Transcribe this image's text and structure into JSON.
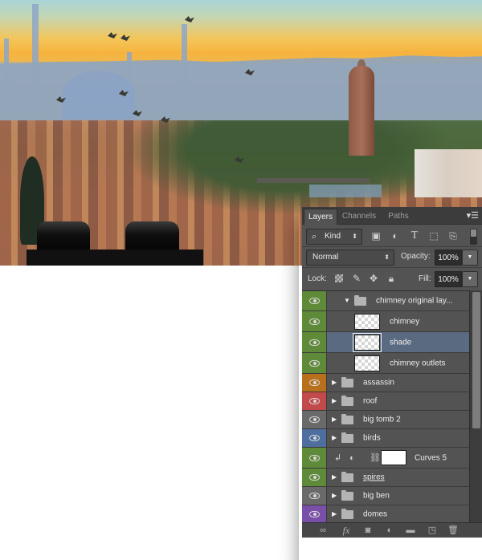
{
  "canvas": {
    "description": "Photoshop composite: Florence cityscape with ghosted mosque, flying birds, tall brick tower and black chimney shapes"
  },
  "layers_panel": {
    "tabs": [
      {
        "label": "Layers",
        "active": true
      },
      {
        "label": "Channels",
        "active": false
      },
      {
        "label": "Paths",
        "active": false
      }
    ],
    "menu_icon": "panel-menu-icon",
    "filter": {
      "kind_label": "Kind",
      "search_icon": "search-icon",
      "filter_icons": [
        "image-filter-icon",
        "adjustment-filter-icon",
        "type-filter-icon",
        "shape-filter-icon",
        "smart-object-filter-icon"
      ],
      "toggle_on": true
    },
    "blend_mode": "Normal",
    "opacity_label": "Opacity:",
    "opacity_value": "100%",
    "lock_label": "Lock:",
    "lock_icons": [
      "lock-transparent-icon",
      "lock-image-icon",
      "lock-position-icon",
      "lock-all-icon"
    ],
    "fill_label": "Fill:",
    "fill_value": "100%",
    "layers": [
      {
        "name": "chimney original lay...",
        "type": "group",
        "expanded": true,
        "visible": true,
        "color": "#5f8a3a",
        "indent": 0
      },
      {
        "name": "chimney",
        "type": "layer",
        "visible": true,
        "color": "#5f8a3a",
        "indent": 1,
        "selected": false
      },
      {
        "name": "shade",
        "type": "layer",
        "visible": true,
        "color": "#5f8a3a",
        "indent": 1,
        "selected": true
      },
      {
        "name": "chimney outlets",
        "type": "layer",
        "visible": true,
        "color": "#5f8a3a",
        "indent": 1,
        "selected": false
      },
      {
        "name": "assassin",
        "type": "group",
        "expanded": false,
        "visible": true,
        "color": "#b8701c"
      },
      {
        "name": "roof",
        "type": "group",
        "expanded": false,
        "visible": true,
        "color": "#c24a4a"
      },
      {
        "name": "big tomb 2",
        "type": "group",
        "expanded": false,
        "visible": true,
        "color": "#6a6a6a"
      },
      {
        "name": "birds",
        "type": "group",
        "expanded": false,
        "visible": true,
        "color": "#4e6ea0"
      },
      {
        "name": "Curves 5",
        "type": "adjustment",
        "visible": true,
        "color": "#5f8a3a",
        "clipped": true
      },
      {
        "name": "spires",
        "type": "group",
        "expanded": false,
        "visible": true,
        "color": "#5f8a3a",
        "underlined": true
      },
      {
        "name": "big ben",
        "type": "group",
        "expanded": false,
        "visible": true,
        "color": "#6a6a6a"
      },
      {
        "name": "domes",
        "type": "group",
        "expanded": false,
        "visible": true,
        "color": "#7a4fa8"
      }
    ],
    "scroll_fraction_visible": 0.6,
    "footer_icons": [
      {
        "name": "link-layers-icon",
        "glyph": "∞"
      },
      {
        "name": "fx-icon",
        "glyph": "fx"
      },
      {
        "name": "add-mask-icon",
        "glyph": "◙"
      },
      {
        "name": "new-adjustment-icon",
        "glyph": "◐"
      },
      {
        "name": "new-group-icon",
        "glyph": "▬"
      },
      {
        "name": "new-layer-icon",
        "glyph": "◳"
      },
      {
        "name": "delete-layer-icon",
        "glyph": "🗑"
      }
    ]
  }
}
